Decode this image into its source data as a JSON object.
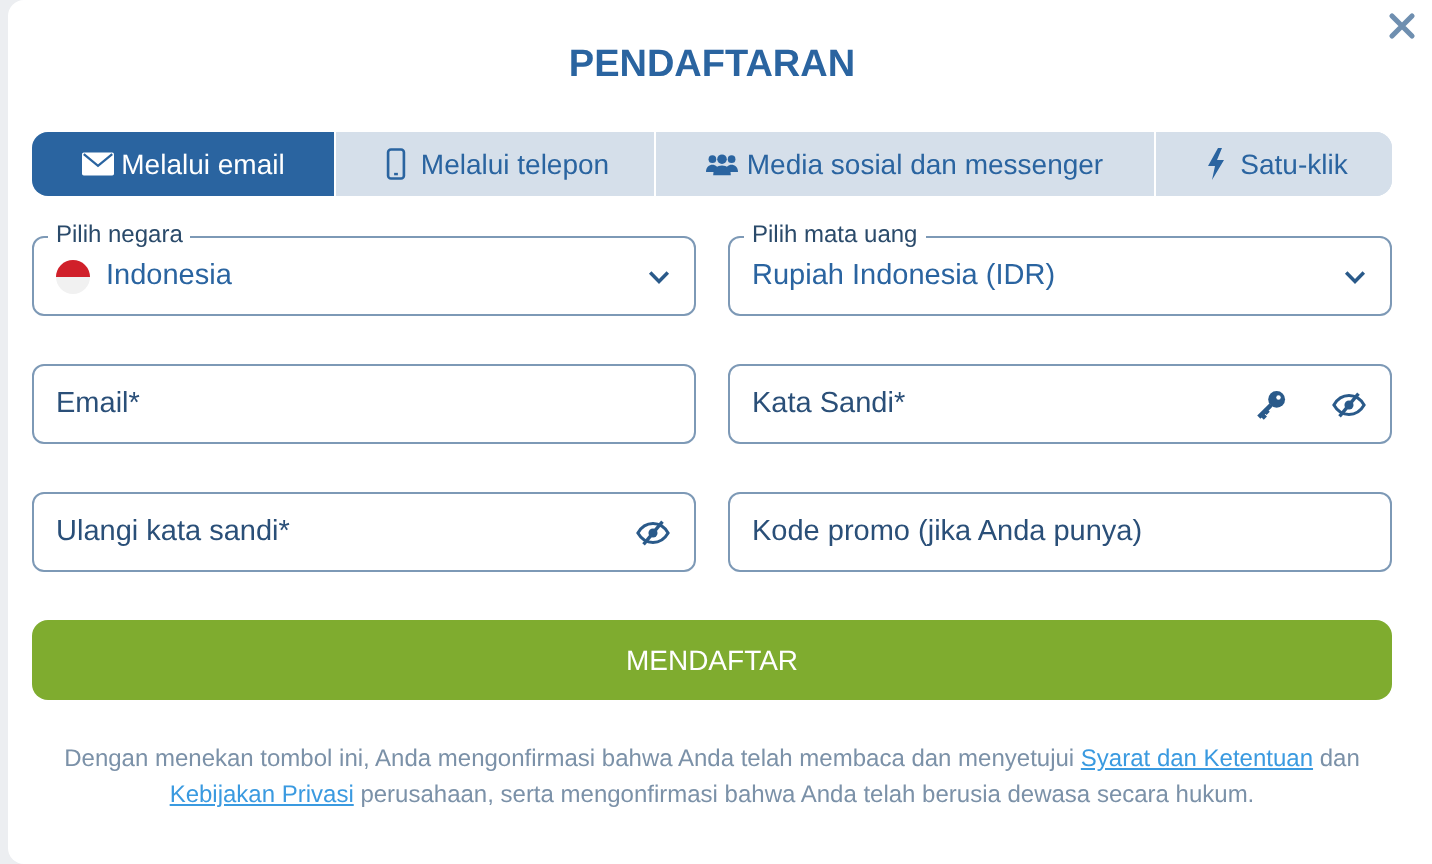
{
  "title": "PENDAFTARAN",
  "tabs": [
    {
      "kind": "email",
      "label": "Melalui email",
      "selected": true
    },
    {
      "kind": "phone",
      "label": "Melalui telepon",
      "selected": false
    },
    {
      "kind": "social",
      "label": "Media sosial dan messenger",
      "selected": false
    },
    {
      "kind": "oneclick",
      "label": "Satu-klik",
      "selected": false
    }
  ],
  "fields": [
    {
      "kind": "select",
      "label": "Pilih negara",
      "value": "Indonesia",
      "flag": true
    },
    {
      "kind": "select",
      "label": "Pilih mata uang",
      "value": "Rupiah Indonesia (IDR)",
      "flag": false
    },
    {
      "kind": "input",
      "placeholder": "Email*",
      "key_button": false,
      "reveal_button": false
    },
    {
      "kind": "input",
      "placeholder": "Kata Sandi*",
      "key_button": true,
      "reveal_button": true
    },
    {
      "kind": "input",
      "placeholder": "Ulangi kata sandi*",
      "key_button": false,
      "reveal_button": true
    },
    {
      "kind": "input",
      "placeholder": "Kode promo (jika Anda punya)",
      "key_button": false,
      "reveal_button": false
    }
  ],
  "submit": "MENDAFTAR",
  "consent": {
    "before": "Dengan menekan tombol ini, Anda mengonfirmasi bahwa Anda telah membaca dan menyetujui ",
    "terms_link": "Syarat dan Ketentuan",
    "middle": " dan ",
    "privacy_link": "Kebijakan Privasi",
    "after": " perusahaan, serta mengonfirmasi bahwa Anda telah berusia dewasa secara hukum."
  }
}
